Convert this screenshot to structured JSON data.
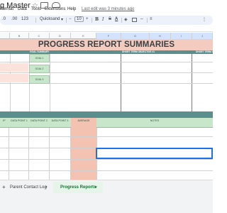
{
  "window": {
    "doc_title": "g Master",
    "star_icon": "star-icon",
    "move_icon": "folder-icon",
    "cloud_icon": "cloud-icon"
  },
  "menu": {
    "items": [
      "Format",
      "Data",
      "Tools",
      "Extensions",
      "Help"
    ],
    "last_edit": "Last edit was 3 minutes ago"
  },
  "toolbar": {
    "decimal_a": ".0",
    "decimal_b": ".00",
    "number_format": "123",
    "font": "Quicksand",
    "font_caret": "▾",
    "minus": "−",
    "font_size": "10",
    "plus": "+",
    "bold": "B",
    "italic": "I",
    "strike": "S",
    "text_color": "A",
    "fill_icon": "paint-bucket-icon",
    "borders_icon": "borders-icon",
    "merge_icon": "merge-icon",
    "align_icon": "≡",
    "more": "⋮"
  },
  "columns": [
    "",
    "B",
    "C",
    "D",
    "E",
    "F",
    "G",
    "H",
    "I",
    "J",
    "K",
    "L"
  ],
  "sheet": {
    "title": "PROGRESS REPORT SUMMARIES",
    "teal_labels": {
      "goal_summary": "GOAL SUMMARY",
      "short_term_1": "SHORT TERM OBJECTIVE #1",
      "short_term_2": "SHORT TERM O"
    },
    "goals": [
      "GOAL 1",
      "GOAL 2",
      "GOAL 3"
    ],
    "data_headers": {
      "col1": "IP",
      "dp1": "DATA POINT 1",
      "dp2": "DATA POINT 2",
      "dp3": "DATA POINT 3",
      "average": "AVERAGE",
      "notes": "NOTES"
    }
  },
  "tabs": {
    "add_icon": "+",
    "menu_icon": "≡",
    "parent_contact": "Parent Contact Log",
    "progress_reports": "Progress Reports",
    "caret": "▾",
    "accent": "#137333"
  },
  "colors": {
    "salmon": "#f4cbbf",
    "teal": "#5b8f8e",
    "green": "#c8e6c9",
    "average_fill": "#f4c2b0"
  }
}
